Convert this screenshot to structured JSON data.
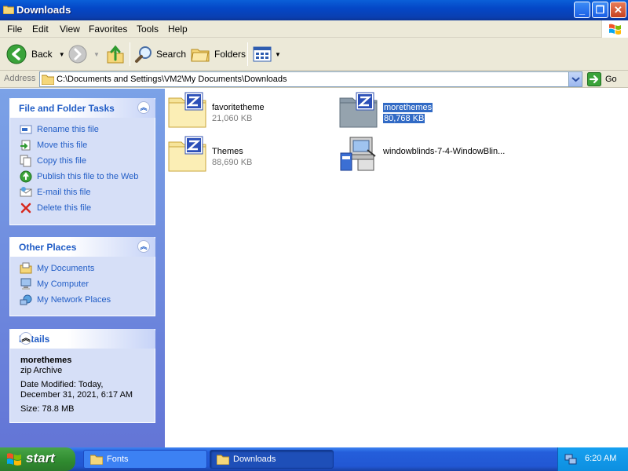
{
  "window": {
    "title": "Downloads",
    "minimize_symbol": "_",
    "maximize_symbol": "❐",
    "close_symbol": "✕"
  },
  "menu": {
    "items": [
      "File",
      "Edit",
      "View",
      "Favorites",
      "Tools",
      "Help"
    ]
  },
  "toolbar": {
    "back_label": "Back",
    "search_label": "Search",
    "folders_label": "Folders"
  },
  "address": {
    "label": "Address",
    "path": "C:\\Documents and Settings\\VM2\\My Documents\\Downloads",
    "go_label": "Go"
  },
  "tasks_panel": {
    "title": "File and Folder Tasks",
    "items": [
      "Rename this file",
      "Move this file",
      "Copy this file",
      "Publish this file to the Web",
      "E-mail this file",
      "Delete this file"
    ]
  },
  "places_panel": {
    "title": "Other Places",
    "items": [
      "My Documents",
      "My Computer",
      "My Network Places"
    ]
  },
  "details_panel": {
    "title": "Details",
    "name": "morethemes",
    "type": "zip Archive",
    "modified_line1": "Date Modified: Today,",
    "modified_line2": "December 31, 2021, 6:17 AM",
    "size": "Size: 78.8 MB"
  },
  "files": [
    {
      "name": "favoritetheme",
      "size": "21,060 KB",
      "icon": "zip-folder-icon",
      "selected": false
    },
    {
      "name": "morethemes",
      "size": "80,768 KB",
      "icon": "zip-folder-icon",
      "selected": true
    },
    {
      "name": "Themes",
      "size": "88,690 KB",
      "icon": "zip-folder-icon",
      "selected": false
    },
    {
      "name": "windowblinds-7-4-WindowBlin...",
      "size": "",
      "icon": "installer-icon",
      "selected": false
    }
  ],
  "taskbar": {
    "start_label": "start",
    "tasks": [
      "Fonts",
      "Downloads"
    ],
    "clock": "6:20 AM"
  },
  "colors": {
    "link_blue": "#215dc6",
    "selection": "#316ac5",
    "title_blue": "#0447c7"
  }
}
